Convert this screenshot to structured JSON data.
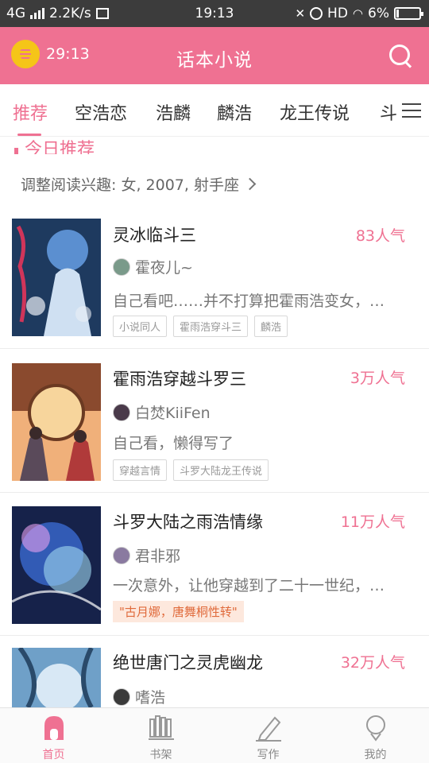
{
  "status_bar": {
    "network": "4G",
    "speed": "2.2K/s",
    "time": "19:13",
    "hd": "HD",
    "battery": "6%"
  },
  "header": {
    "timer": "29:13",
    "title": "话本小说"
  },
  "tabs": [
    {
      "label": "推荐",
      "active": true
    },
    {
      "label": "空浩恋"
    },
    {
      "label": "浩麟"
    },
    {
      "label": "麟浩"
    },
    {
      "label": "龙王传说"
    },
    {
      "label": "斗"
    }
  ],
  "section": {
    "title": "今日推荐",
    "interest": "调整阅读兴趣: 女, 2007, 射手座"
  },
  "books": [
    {
      "title": "灵冰临斗三",
      "popularity": "83人气",
      "author": "霍夜儿~",
      "desc": "自己看吧……并不打算把霍雨浩变女，…",
      "tags": [
        "小说同人",
        "霍雨浩穿斗三",
        "麟浩"
      ]
    },
    {
      "title": "霍雨浩穿越斗罗三",
      "popularity": "3万人气",
      "author": "白焚KiiFen",
      "desc": "自己看，懒得写了",
      "tags": [
        "穿越言情",
        "斗罗大陆龙王传说"
      ]
    },
    {
      "title": "斗罗大陆之雨浩情缘",
      "popularity": "11万人气",
      "author": "君非邪",
      "desc": "一次意外，让他穿越到了二十一世纪，…",
      "highlight": "\"古月娜，唐舞桐性转\""
    },
    {
      "title": "绝世唐门之灵虎幽龙",
      "popularity": "32万人气",
      "author": "嗜浩"
    }
  ],
  "bottom_nav": [
    {
      "label": "首页",
      "icon": "home-icon",
      "active": true
    },
    {
      "label": "书架",
      "icon": "bookshelf-icon"
    },
    {
      "label": "写作",
      "icon": "pencil-icon"
    },
    {
      "label": "我的",
      "icon": "profile-icon"
    }
  ],
  "colors": {
    "accent": "#ef7192",
    "timer_icon": "#f5c518",
    "highlight_tag_text": "#e06a3b",
    "highlight_tag_bg": "#fde8dd"
  }
}
